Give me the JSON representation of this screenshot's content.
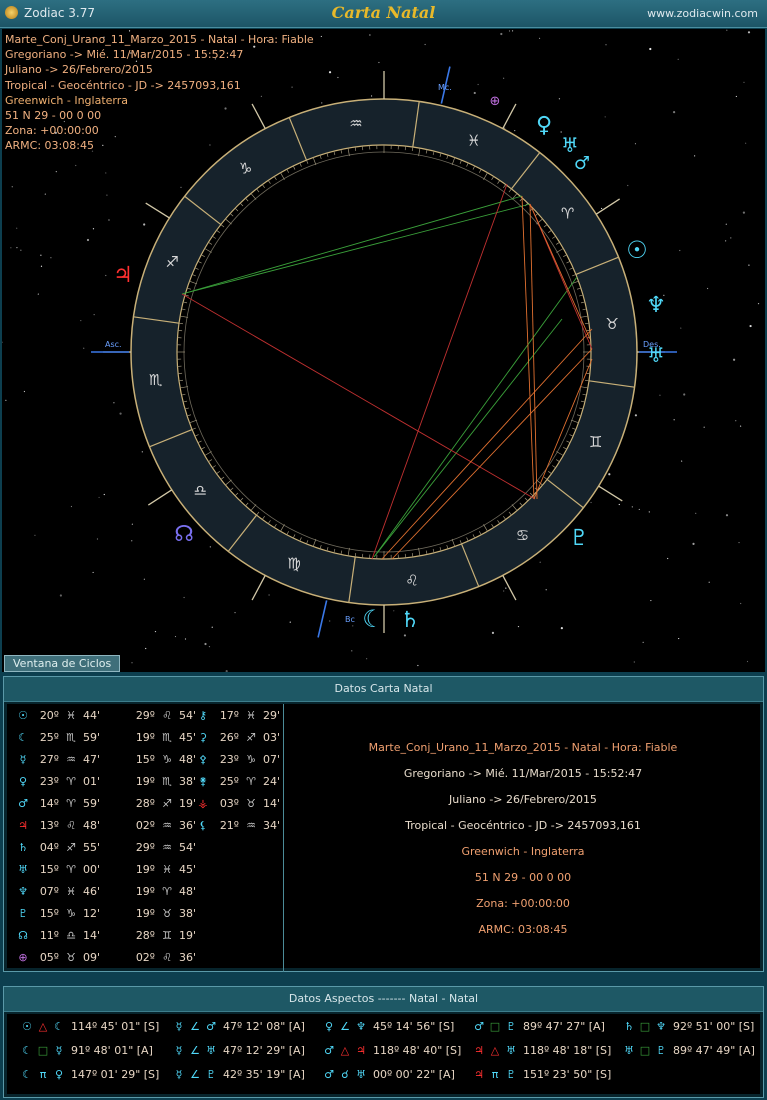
{
  "window": {
    "app_name": "Zodiac 3.77",
    "title": "Carta Natal",
    "website": "www.zodiacwin.com"
  },
  "chart_info": {
    "lines": [
      "Marte_Conj_Urano_11_Marzo_2015 - Natal - Hora: Fiable",
      "Gregoriano -> Mié. 11/Mar/2015 - 15:52:47",
      "Juliano -> 26/Febrero/2015",
      "Tropical - Geocéntrico - JD -> 2457093,161",
      "Greenwich - Inglaterra",
      "51 N 29 - 00 0 00",
      "Zona: +00:00:00",
      "ARMC: 03:08:45"
    ]
  },
  "wheel": {
    "axis_labels": {
      "mc": "Mc.",
      "asc": "Asc.",
      "des": "Des.",
      "bc": "Bc"
    },
    "sign_glyphs": [
      "♈",
      "♉",
      "♊",
      "♋",
      "♌",
      "♍",
      "♎",
      "♏",
      "♐",
      "♑",
      "♒",
      "♓"
    ]
  },
  "tabs": {
    "ciclos": "Ventana de Ciclos"
  },
  "natal_panel": {
    "title": "Datos Carta Natal",
    "columns": [
      [
        {
          "glyph": "☉",
          "color": "#50d8f8",
          "deg": "20º",
          "sign": "♓",
          "min": "44'"
        },
        {
          "glyph": "☾",
          "color": "#50d8f8",
          "deg": "25º",
          "sign": "♏",
          "min": "59'"
        },
        {
          "glyph": "☿",
          "color": "#50d8f8",
          "deg": "27º",
          "sign": "♒",
          "min": "47'"
        },
        {
          "glyph": "♀",
          "color": "#50d8f8",
          "deg": "23º",
          "sign": "♈",
          "min": "01'"
        },
        {
          "glyph": "♂",
          "color": "#50d8f8",
          "deg": "14º",
          "sign": "♈",
          "min": "59'"
        },
        {
          "glyph": "♃",
          "color": "#ff3030",
          "deg": "13º",
          "sign": "♌",
          "min": "48'"
        },
        {
          "glyph": "♄",
          "color": "#50d8f8",
          "deg": "04º",
          "sign": "♐",
          "min": "55'"
        },
        {
          "glyph": "♅",
          "color": "#50d8f8",
          "deg": "15º",
          "sign": "♈",
          "min": "00'"
        },
        {
          "glyph": "♆",
          "color": "#50d8f8",
          "deg": "07º",
          "sign": "♓",
          "min": "46'"
        },
        {
          "glyph": "♇",
          "color": "#50d8f8",
          "deg": "15º",
          "sign": "♑",
          "min": "12'"
        },
        {
          "glyph": "☊",
          "color": "#50d8f8",
          "deg": "11º",
          "sign": "♎",
          "min": "14'"
        },
        {
          "glyph": "⊕",
          "color": "#c070e0",
          "deg": "05º",
          "sign": "♉",
          "min": "09'"
        }
      ],
      [
        {
          "deg": "29º",
          "sign": "♌",
          "min": "54'"
        },
        {
          "deg": "19º",
          "sign": "♏",
          "min": "45'"
        },
        {
          "deg": "15º",
          "sign": "♑",
          "min": "48'"
        },
        {
          "deg": "19º",
          "sign": "♏",
          "min": "38'"
        },
        {
          "deg": "28º",
          "sign": "♐",
          "min": "19'"
        },
        {
          "deg": "02º",
          "sign": "♒",
          "min": "36'"
        },
        {
          "deg": "29º",
          "sign": "♒",
          "min": "54'"
        },
        {
          "deg": "19º",
          "sign": "♓",
          "min": "45'"
        },
        {
          "deg": "19º",
          "sign": "♈",
          "min": "48'"
        },
        {
          "deg": "19º",
          "sign": "♉",
          "min": "38'"
        },
        {
          "deg": "28º",
          "sign": "♊",
          "min": "19'"
        },
        {
          "deg": "02º",
          "sign": "♌",
          "min": "36'"
        }
      ],
      [
        {
          "glyph": "⚷",
          "color": "#50d8f8",
          "deg": "17º",
          "sign": "♓",
          "min": "29'"
        },
        {
          "glyph": "⚳",
          "color": "#50d8f8",
          "deg": "26º",
          "sign": "♐",
          "min": "03'"
        },
        {
          "glyph": "⚴",
          "color": "#50d8f8",
          "deg": "23º",
          "sign": "♑",
          "min": "07'"
        },
        {
          "glyph": "⚵",
          "color": "#50d8f8",
          "deg": "25º",
          "sign": "♈",
          "min": "24'"
        },
        {
          "glyph": "⚶",
          "color": "#ff3030",
          "deg": "03º",
          "sign": "♉",
          "min": "14'"
        },
        {
          "glyph": "⚸",
          "color": "#50d8f8",
          "deg": "21º",
          "sign": "♒",
          "min": "34'"
        }
      ]
    ],
    "summary": [
      {
        "text": "Marte_Conj_Urano_11_Marzo_2015 - Natal - Hora: Fiable",
        "color": "#f0a070"
      },
      {
        "text": "Gregoriano -> Mié. 11/Mar/2015 - 15:52:47",
        "color": "#e8dccc"
      },
      {
        "text": "Juliano -> 26/Febrero/2015",
        "color": "#e8dccc"
      },
      {
        "text": "Tropical - Geocéntrico - JD -> 2457093,161",
        "color": "#e8dccc"
      },
      {
        "text": "Greenwich - Inglaterra",
        "color": "#f0a070"
      },
      {
        "text": "51 N 29 - 00 0 00",
        "color": "#f0a070"
      },
      {
        "text": "Zona: +00:00:00",
        "color": "#f0a070"
      },
      {
        "text": "ARMC: 03:08:45",
        "color": "#f0a070"
      }
    ]
  },
  "aspects_panel": {
    "title": "Datos Aspectos     -------     Natal - Natal",
    "rows": [
      [
        {
          "p1": "☉",
          "asp": "△",
          "p2": "☾",
          "val": "114º 45' 01\" [S]"
        },
        {
          "p1": "☿",
          "asp": "∠",
          "p2": "♂",
          "val": "47º 12' 08\" [A]"
        },
        {
          "p1": "♀",
          "asp": "∠",
          "p2": "♆",
          "val": "45º 14' 56\" [S]"
        },
        {
          "p1": "♂",
          "asp": "□",
          "p2": "♇",
          "val": "89º 47' 27\" [A]"
        },
        {
          "p1": "♄",
          "asp": "□",
          "p2": "♆",
          "val": "92º 51' 00\" [S]"
        }
      ],
      [
        {
          "p1": "☾",
          "asp": "□",
          "p2": "☿",
          "val": "91º 48' 01\" [A]"
        },
        {
          "p1": "☿",
          "asp": "∠",
          "p2": "♅",
          "val": "47º 12' 29\" [A]"
        },
        {
          "p1": "♂",
          "asp": "△",
          "p2": "♃",
          "val": "118º 48' 40\" [S]"
        },
        {
          "p1": "♃",
          "asp": "△",
          "p2": "♅",
          "val": "118º 48' 18\" [S]"
        },
        {
          "p1": "♅",
          "asp": "□",
          "p2": "♇",
          "val": "89º 47' 49\" [A]"
        }
      ],
      [
        {
          "p1": "☾",
          "asp": "π",
          "p2": "♀",
          "val": "147º 01' 29\" [S]"
        },
        {
          "p1": "☿",
          "asp": "∠",
          "p2": "♇",
          "val": "42º 35' 19\" [A]"
        },
        {
          "p1": "♂",
          "asp": "☌",
          "p2": "♅",
          "val": "00º 00' 22\" [A]"
        },
        {
          "p1": "♃",
          "asp": "π",
          "p2": "♇",
          "val": "151º 23' 50\" [S]"
        }
      ]
    ]
  },
  "colors": {
    "accent": "#e8b92a",
    "panel": "#1e5865",
    "planet": "#50d8f8",
    "jupiter": "#ff3030"
  }
}
